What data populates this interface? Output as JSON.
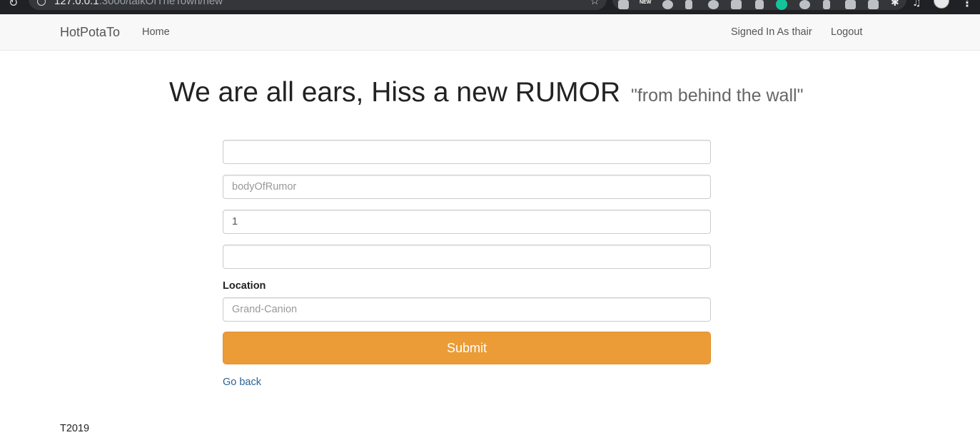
{
  "browser": {
    "url_host": "127.0.0.1",
    "url_rest": ":3000/talkOfTheTown/new"
  },
  "navbar": {
    "brand": "HotPotaTo",
    "home": "Home",
    "signed_in": "Signed In As thair",
    "logout": "Logout"
  },
  "heading": {
    "title": "We are all ears, Hiss a new RUMOR",
    "subtitle": "\"from behind the wall\""
  },
  "form": {
    "title_value": "",
    "body_placeholder": "bodyOfRumor",
    "number_value": "1",
    "extra_value": "",
    "location_label": "Location",
    "location_placeholder": "Grand-Canion",
    "submit_label": "Submit"
  },
  "links": {
    "go_back": "Go back"
  },
  "footer": {
    "text": "T2019"
  },
  "colors": {
    "submit_bg": "#eb9c37",
    "link": "#2a6496",
    "navbar_bg": "#f8f8f8"
  }
}
